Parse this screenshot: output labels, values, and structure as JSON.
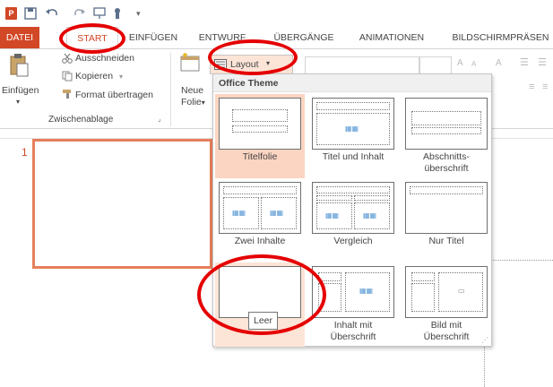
{
  "qat": {
    "app_badge": "P"
  },
  "tabs": [
    "DATEI",
    "START",
    "EINFÜGEN",
    "ENTWURF",
    "ÜBERGÄNGE",
    "ANIMATIONEN",
    "BILDSCHIRMPRÄSEN"
  ],
  "ribbon": {
    "cut": "Ausschneiden",
    "copy": "Kopieren",
    "format_painter": "Format übertragen",
    "paste": "Einfügen",
    "new_slide_line1": "Neue",
    "new_slide_line2": "Folie",
    "group_clipboard": "Zwischenablage",
    "layout": "Layout"
  },
  "dropdown": {
    "header": "Office Theme",
    "layouts": [
      {
        "label": "Titelfolie",
        "selected": true
      },
      {
        "label": "Titel und Inhalt",
        "selected": false
      },
      {
        "label": "Abschnitts-\nüberschrift",
        "selected": false
      },
      {
        "label": "Zwei Inhalte",
        "selected": false
      },
      {
        "label": "Vergleich",
        "selected": false
      },
      {
        "label": "Nur Titel",
        "selected": false
      },
      {
        "label": "Leer",
        "selected": false
      },
      {
        "label": "Inhalt mit\nÜberschrift",
        "selected": false
      },
      {
        "label": "Bild mit\nÜberschrift",
        "selected": false
      }
    ]
  },
  "slide_panel": {
    "slide_number": "1"
  },
  "tooltip": "Leer",
  "colors": {
    "accent": "#d24726",
    "selected_tile": "#fcd5c2",
    "annotation": "#e50000"
  }
}
